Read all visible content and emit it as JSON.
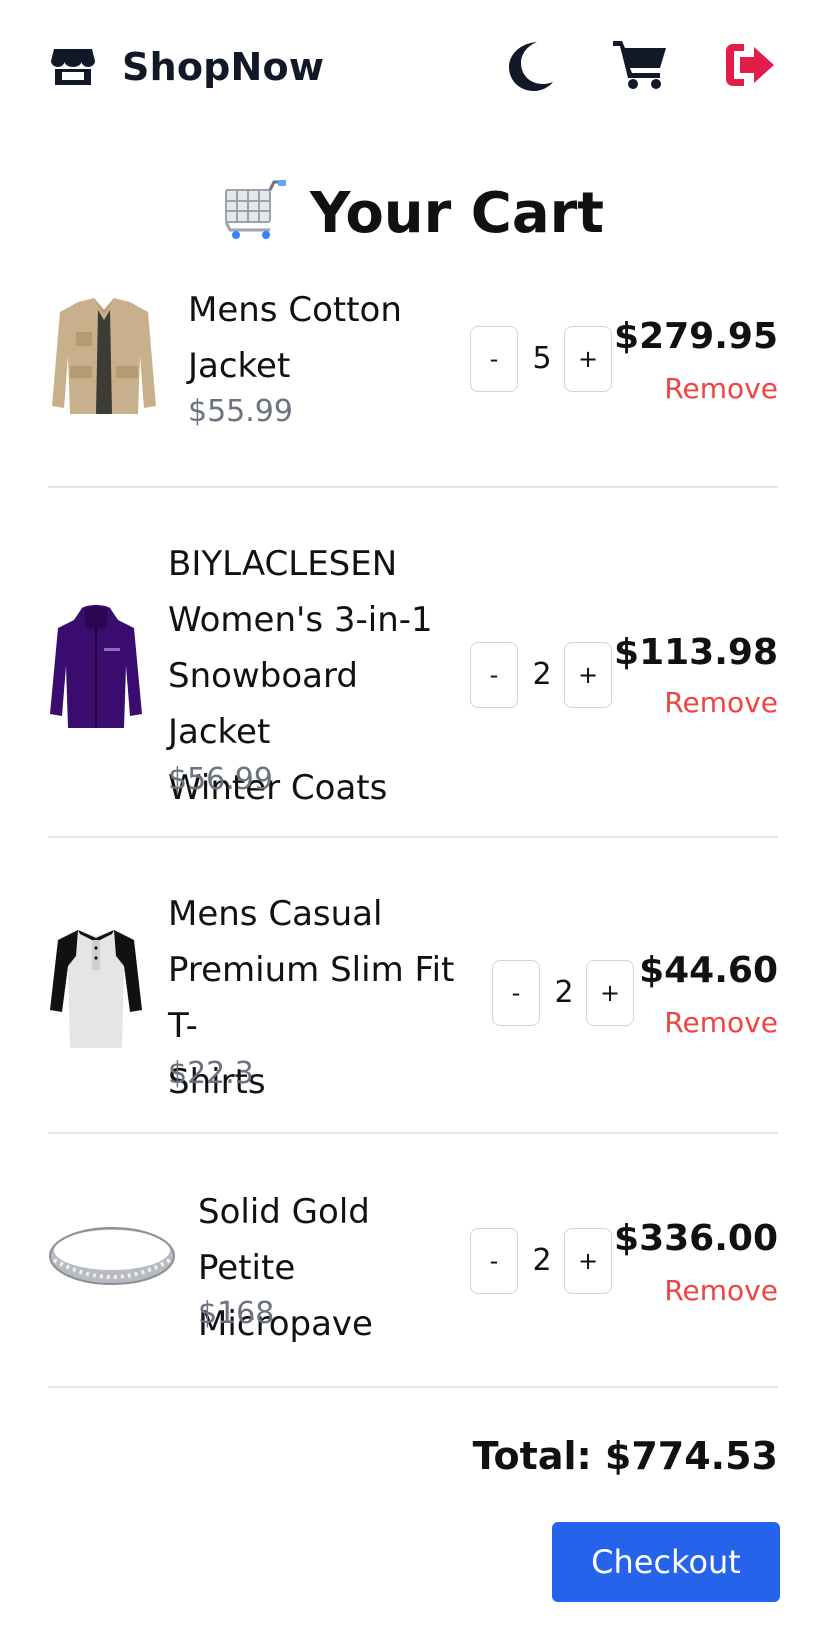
{
  "header": {
    "brand": "ShopNow",
    "icons": [
      "store-icon",
      "moon-icon",
      "cart-icon",
      "logout-icon"
    ],
    "logout_color": "#e11d48"
  },
  "cart": {
    "title": "Your Cart",
    "items": [
      {
        "name_lines": [
          "Mens Cotton",
          "Jacket"
        ],
        "unit_price": "$55.99",
        "quantity": "5",
        "line_total": "$279.95",
        "remove_label": "Remove",
        "minus_label": "-",
        "plus_label": "+"
      },
      {
        "name_lines": [
          "BIYLACLESEN",
          "Women's 3-in-1",
          "Snowboard Jacket",
          "Winter Coats"
        ],
        "unit_price": "$56.99",
        "quantity": "2",
        "line_total": "$113.98",
        "remove_label": "Remove",
        "minus_label": "-",
        "plus_label": "+"
      },
      {
        "name_lines": [
          "Mens Casual",
          "Premium Slim Fit T-",
          "Shirts"
        ],
        "unit_price": "$22.3",
        "quantity": "2",
        "line_total": "$44.60",
        "remove_label": "Remove",
        "minus_label": "-",
        "plus_label": "+"
      },
      {
        "name_lines": [
          "Solid Gold Petite",
          "Micropave"
        ],
        "unit_price": "$168",
        "quantity": "2",
        "line_total": "$336.00",
        "remove_label": "Remove",
        "minus_label": "-",
        "plus_label": "+"
      }
    ],
    "total": "Total: $774.53",
    "checkout_label": "Checkout",
    "colors": {
      "accent": "#2563eb",
      "remove": "#ef4444",
      "muted": "#6b7280"
    }
  }
}
